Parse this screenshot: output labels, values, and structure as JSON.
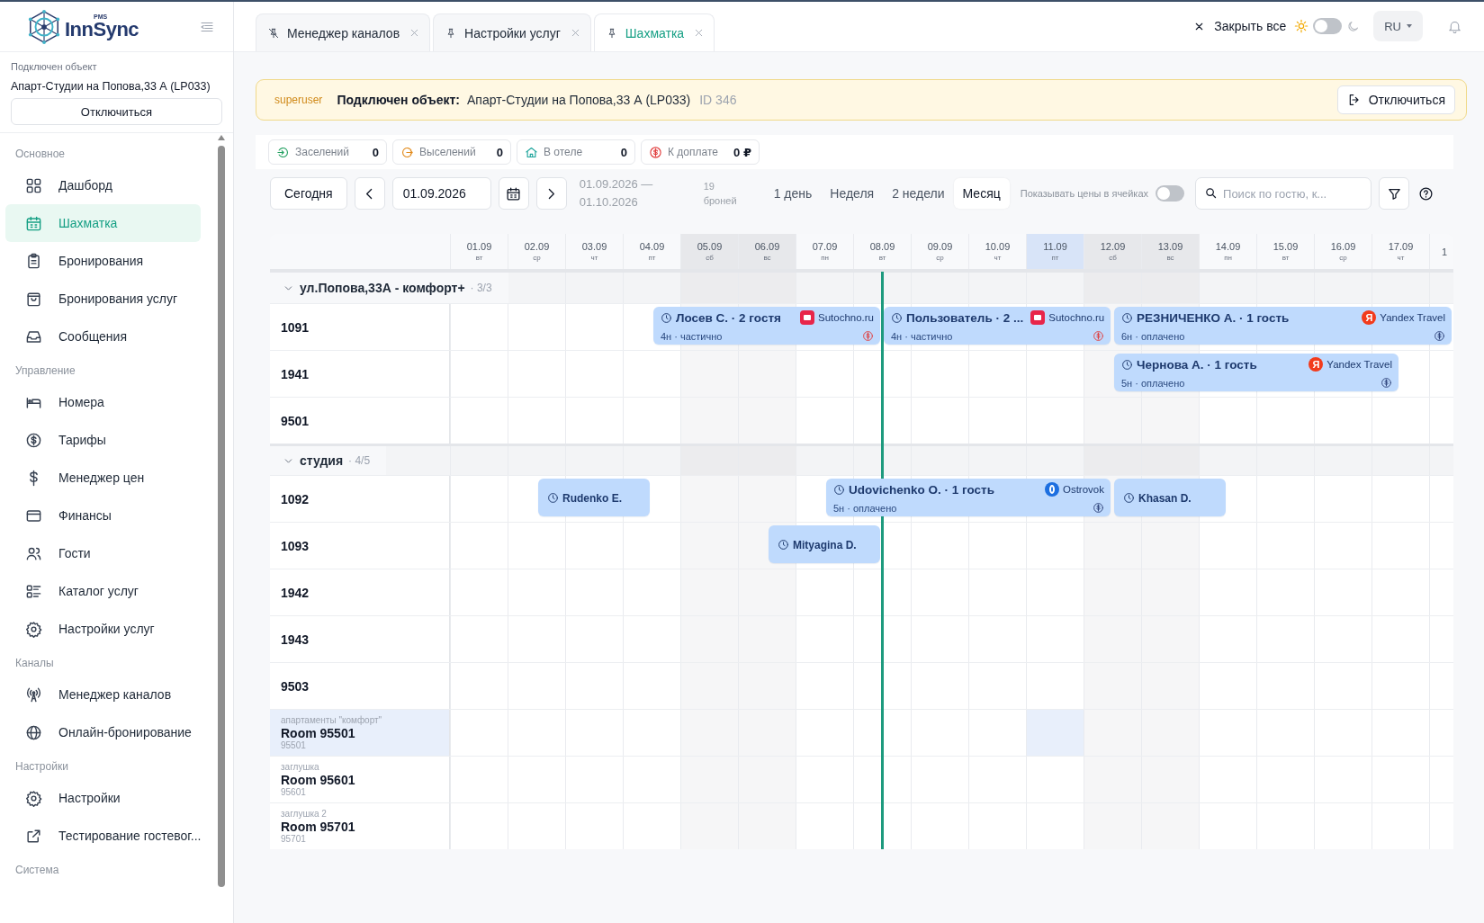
{
  "sidebar": {
    "logo": {
      "tag": "PMS",
      "name": "InnSync"
    },
    "connected_label": "Подключен объект",
    "property": "Апарт-Студии на Попова,33 А (LP033)",
    "disconnect": "Отключиться",
    "sections": [
      {
        "title": "Основное",
        "items": [
          {
            "label": "Дашборд",
            "kind": "grid",
            "selected": false
          },
          {
            "label": "Шахматка",
            "kind": "calendar",
            "selected": true
          },
          {
            "label": "Бронирования",
            "kind": "clipboard",
            "selected": false
          },
          {
            "label": "Бронирования услуг",
            "kind": "bag",
            "selected": false
          },
          {
            "label": "Сообщения",
            "kind": "inbox",
            "selected": false
          }
        ]
      },
      {
        "title": "Управление",
        "items": [
          {
            "label": "Номера",
            "kind": "bed",
            "selected": false
          },
          {
            "label": "Тарифы",
            "kind": "coin",
            "selected": false
          },
          {
            "label": "Менеджер цен",
            "kind": "dollar",
            "selected": false
          },
          {
            "label": "Финансы",
            "kind": "wallet",
            "selected": false
          },
          {
            "label": "Гости",
            "kind": "users",
            "selected": false
          },
          {
            "label": "Каталог услуг",
            "kind": "list",
            "selected": false
          },
          {
            "label": "Настройки услуг",
            "kind": "gear",
            "selected": false
          }
        ]
      },
      {
        "title": "Каналы",
        "items": [
          {
            "label": "Менеджер каналов",
            "kind": "antenna",
            "selected": false
          },
          {
            "label": "Онлайн-бронирование",
            "kind": "globe",
            "selected": false
          }
        ]
      },
      {
        "title": "Настройки",
        "items": [
          {
            "label": "Настройки",
            "kind": "gear",
            "selected": false
          },
          {
            "label": "Тестирование гостевог...",
            "kind": "external",
            "selected": false
          }
        ]
      },
      {
        "title": "Система"
      }
    ]
  },
  "tabs": [
    {
      "label": "Менеджер каналов",
      "pinned": false,
      "selected": false
    },
    {
      "label": "Настройки услуг",
      "pinned": true,
      "selected": false
    },
    {
      "label": "Шахматка",
      "pinned": true,
      "selected": true
    }
  ],
  "topbar": {
    "close_all": "Закрыть все",
    "dark_mode": false,
    "language": "RU"
  },
  "banner": {
    "role": "superuser",
    "label": "Подключен объект:",
    "property": "Апарт-Студии на Попова,33 А (LP033)",
    "id": "ID 346",
    "button": "Отключиться"
  },
  "stats": [
    {
      "kind": "checkin",
      "label": "Заселений",
      "value": "0"
    },
    {
      "kind": "checkout",
      "label": "Выселений",
      "value": "0"
    },
    {
      "kind": "hotel",
      "label": "В отеле",
      "value": "0"
    },
    {
      "kind": "payment",
      "label": "К доплате",
      "value": "0 ₽"
    }
  ],
  "toolbar": {
    "today": "Сегодня",
    "date": "01.09.2026",
    "range_start": "01.09.2026 —",
    "range_end": "01.10.2026",
    "count": "19",
    "count_label": "броней",
    "views": [
      {
        "label": "1 день",
        "selected": false
      },
      {
        "label": "Неделя",
        "selected": false
      },
      {
        "label": "2 недели",
        "selected": false
      },
      {
        "label": "Месяц",
        "selected": true
      }
    ],
    "prices_label": "Показывать цены в ячейках",
    "show_prices": false,
    "search_placeholder": "Поиск по гостю, к..."
  },
  "grid": {
    "days": [
      {
        "date": "01.09",
        "weekday": "вт",
        "weekend": false,
        "highlighted": false
      },
      {
        "date": "02.09",
        "weekday": "ср",
        "weekend": false,
        "highlighted": false
      },
      {
        "date": "03.09",
        "weekday": "чт",
        "weekend": false,
        "highlighted": false
      },
      {
        "date": "04.09",
        "weekday": "пт",
        "weekend": false,
        "highlighted": false
      },
      {
        "date": "05.09",
        "weekday": "сб",
        "weekend": true,
        "highlighted": false
      },
      {
        "date": "06.09",
        "weekday": "вс",
        "weekend": true,
        "highlighted": false
      },
      {
        "date": "07.09",
        "weekday": "пн",
        "weekend": false,
        "highlighted": false
      },
      {
        "date": "08.09",
        "weekday": "вт",
        "weekend": false,
        "highlighted": false
      },
      {
        "date": "09.09",
        "weekday": "ср",
        "weekend": false,
        "highlighted": false
      },
      {
        "date": "10.09",
        "weekday": "чт",
        "weekend": false,
        "highlighted": false
      },
      {
        "date": "11.09",
        "weekday": "пт",
        "weekend": false,
        "highlighted": true
      },
      {
        "date": "12.09",
        "weekday": "сб",
        "weekend": true,
        "highlighted": false
      },
      {
        "date": "13.09",
        "weekday": "вс",
        "weekend": true,
        "highlighted": false
      },
      {
        "date": "14.09",
        "weekday": "пн",
        "weekend": false,
        "highlighted": false
      },
      {
        "date": "15.09",
        "weekday": "вт",
        "weekend": false,
        "highlighted": false
      },
      {
        "date": "16.09",
        "weekday": "ср",
        "weekend": false,
        "highlighted": false
      },
      {
        "date": "17.09",
        "weekday": "чт",
        "weekend": false,
        "highlighted": false
      },
      {
        "date": "1",
        "weekend": false,
        "highlighted": false
      }
    ],
    "groups": [
      {
        "name": "ул.Попова,33А - комфорт+",
        "count": "· 3/3",
        "expanded": true,
        "rooms": [
          {
            "number": "1091",
            "selected": false,
            "bookings": [
              {
                "kind": "partial",
                "guest": "Лосев С. · 2 гостя",
                "details": "4н · частично",
                "channel": {
                  "kind": "sutochno",
                  "name": "Sutochno.ru"
                }
              },
              {
                "kind": "partial",
                "guest": "Пользователь · 2 ...",
                "details": "4н · частично",
                "channel": {
                  "kind": "sutochno",
                  "name": "Sutochno.ru"
                }
              },
              {
                "kind": "paid",
                "guest": "РЕЗНИЧЕНКО А. · 1 гость",
                "details": "6н · оплачено",
                "channel": {
                  "kind": "yandex",
                  "name": "Yandex Travel",
                  "logo": "Я"
                }
              }
            ]
          },
          {
            "number": "1941",
            "selected": false,
            "bookings": [
              {
                "kind": "paid",
                "guest": "Чернова А. · 1 гость",
                "details": "5н · оплачено",
                "channel": {
                  "kind": "yandex",
                  "name": "Yandex Travel",
                  "logo": "Я"
                }
              }
            ]
          },
          {
            "number": "9501",
            "selected": false
          }
        ]
      },
      {
        "name": "студия",
        "count": "· 4/5",
        "expanded": true,
        "rooms": [
          {
            "number": "1092",
            "selected": false,
            "bookings": [
              {
                "kind": "short",
                "guest": "Rudenko E."
              },
              {
                "kind": "paid",
                "guest": "Udovichenko O. · 1 гость",
                "details": "5н · оплачено",
                "channel": {
                  "kind": "ostrovok",
                  "name": "Ostrovok"
                }
              },
              {
                "kind": "short",
                "guest": "Khasan D."
              }
            ]
          },
          {
            "number": "1093",
            "selected": false,
            "bookings": [
              {
                "kind": "short",
                "guest": "Mityagina D."
              }
            ]
          },
          {
            "number": "1942",
            "selected": false
          },
          {
            "number": "1943",
            "selected": false
          },
          {
            "number": "9503",
            "selected": false
          },
          {
            "type": "апартаменты \"комфорт\"",
            "number": "Room 95501",
            "code": "95501",
            "selected": true
          },
          {
            "type": "заглушка",
            "number": "Room 95601",
            "code": "95601",
            "selected": false
          },
          {
            "type": "заглушка 2",
            "number": "Room 95701",
            "code": "95701",
            "selected": false
          }
        ]
      }
    ]
  }
}
